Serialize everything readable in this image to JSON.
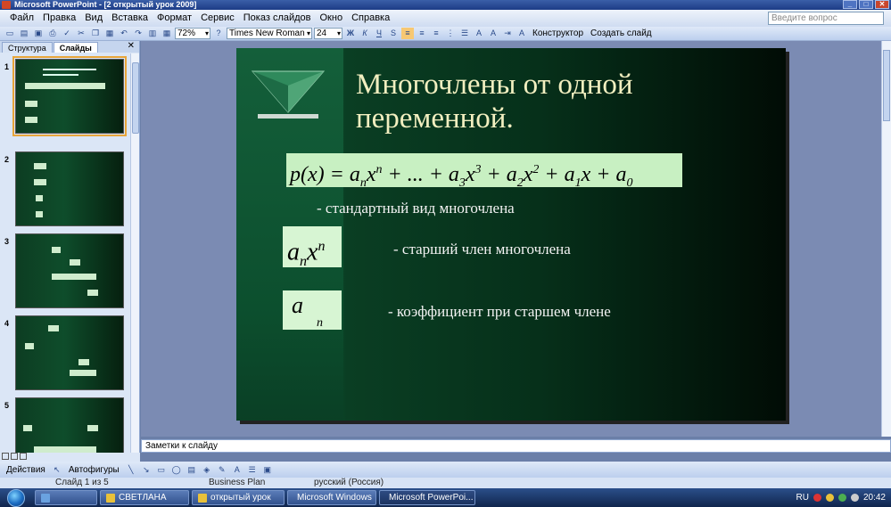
{
  "window": {
    "title": "Microsoft PowerPoint - [2 открытый урок 2009]"
  },
  "menu": {
    "items": [
      "Файл",
      "Правка",
      "Вид",
      "Вставка",
      "Формат",
      "Сервис",
      "Показ слайдов",
      "Окно",
      "Справка"
    ],
    "help_placeholder": "Введите вопрос"
  },
  "toolbar": {
    "zoom": "72%",
    "font": "Times New Roman",
    "size": "24",
    "designer_label": "Конструктор",
    "create_slide_label": "Создать слайд"
  },
  "leftpanel": {
    "tabs": [
      "Структура",
      "Слайды"
    ],
    "slide_numbers": [
      "1",
      "2",
      "3",
      "4",
      "5"
    ]
  },
  "slide": {
    "title": "Многочлены от одной переменной.",
    "formula_px": "p(x) = a",
    "formula_rest": " + ... + a",
    "formula_tail": " + a",
    "item1": "-  стандартный вид многочлена",
    "item2": "- старший член многочлена",
    "item3": "-  коэффициент при старшем члене"
  },
  "notes": {
    "placeholder": "Заметки к слайду"
  },
  "drawbar": {
    "actions_label": "Действия",
    "autoshapes_label": "Автофигуры"
  },
  "status": {
    "slide": "Слайд 1 из 5",
    "design": "Business Plan",
    "language": "русский (Россия)"
  },
  "taskbar": {
    "items": [
      "СВЕТЛАНА",
      "открытый урок",
      "Microsoft Windows",
      "Microsoft PowerPoi..."
    ],
    "lang": "RU",
    "time": "20:42"
  }
}
